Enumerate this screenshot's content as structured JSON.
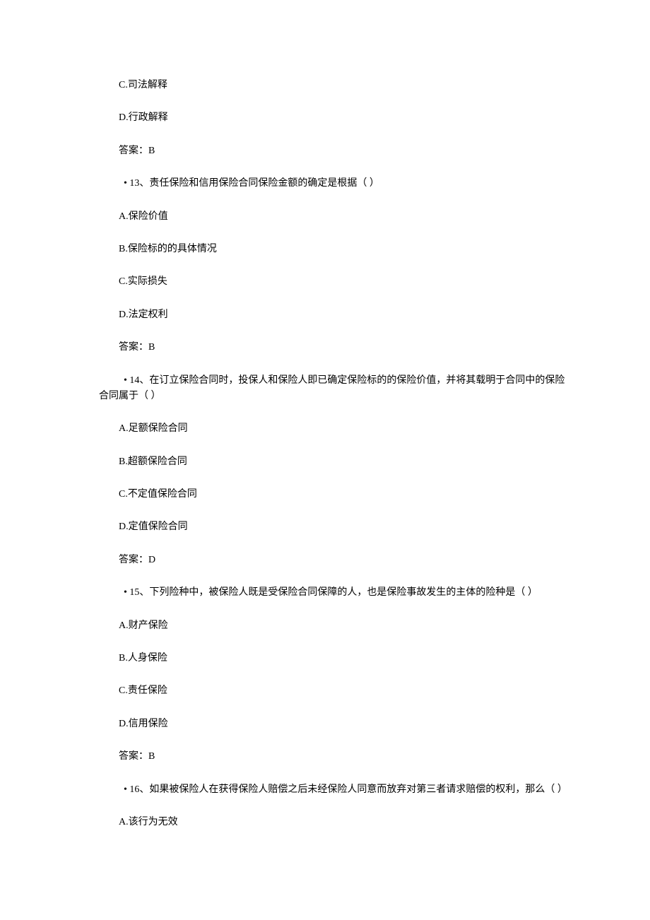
{
  "lines": [
    {
      "text": "C.司法解释",
      "indent": "indent-1"
    },
    {
      "text": "D.行政解释",
      "indent": "indent-1"
    },
    {
      "text": "答案：B",
      "indent": "indent-1"
    },
    {
      "text": "• 13、责任保险和信用保险合同保险金额的确定是根据（ ）",
      "indent": "indent-2"
    },
    {
      "text": "A.保险价值",
      "indent": "indent-1"
    },
    {
      "text": "B.保险标的的具体情况",
      "indent": "indent-1"
    },
    {
      "text": "C.实际损失",
      "indent": "indent-1"
    },
    {
      "text": "D.法定权利",
      "indent": "indent-1"
    },
    {
      "text": "答案：B",
      "indent": "indent-1"
    },
    {
      "text": "• 14、在订立保险合同时，投保人和保险人即已确定保险标的的保险价值，并将其载明于合同中的保险合同属于（ ）",
      "indent": "indent-2",
      "wrap": true
    },
    {
      "text": "A.足额保险合同",
      "indent": "indent-1"
    },
    {
      "text": "B.超额保险合同",
      "indent": "indent-1"
    },
    {
      "text": "C.不定值保险合同",
      "indent": "indent-1"
    },
    {
      "text": "D.定值保险合同",
      "indent": "indent-1"
    },
    {
      "text": "答案：D",
      "indent": "indent-1"
    },
    {
      "text": "• 15、下列险种中，被保险人既是受保险合同保障的人，也是保险事故发生的主体的险种是（ ）",
      "indent": "indent-2"
    },
    {
      "text": "A.财产保险",
      "indent": "indent-1"
    },
    {
      "text": "B.人身保险",
      "indent": "indent-1"
    },
    {
      "text": "C.责任保险",
      "indent": "indent-1"
    },
    {
      "text": "D.信用保险",
      "indent": "indent-1"
    },
    {
      "text": "答案：B",
      "indent": "indent-1"
    },
    {
      "text": "• 16、如果被保险人在获得保险人赔偿之后未经保险人同意而放弃对第三者请求赔偿的权利，那么（ ）",
      "indent": "indent-2",
      "wrap": true,
      "wrapNoIndent": true
    },
    {
      "text": "A.该行为无效",
      "indent": "indent-1"
    }
  ]
}
